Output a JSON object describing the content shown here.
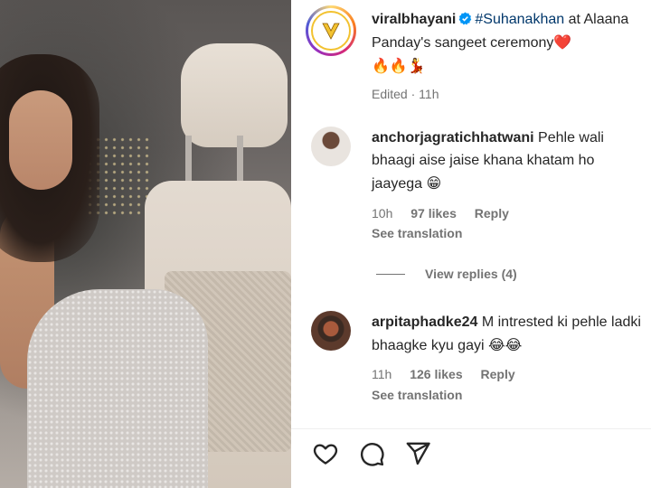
{
  "post": {
    "username": "viralbhayani",
    "hashtag": "#Suhanakhan",
    "caption_part1": " at Alaana Panday's sangeet ceremony",
    "caption_emoji_heart": "❤️",
    "caption_emojis_line2": "🔥🔥💃",
    "edited_label": "Edited",
    "separator": " · ",
    "time_ago": "11h"
  },
  "comments": [
    {
      "username": "anchorjagratichhatwani",
      "text": "Pehle wali bhaagi aise jaise khana khatam ho jaayega",
      "emoji": "😁",
      "time": "10h",
      "likes": "97 likes",
      "reply_label": "Reply",
      "see_translation": "See translation"
    },
    {
      "username": "arpitaphadke24",
      "text": "M intrested ki pehle ladki bhaagke kyu gayi",
      "emoji": "😂😂",
      "time": "11h",
      "likes": "126 likes",
      "reply_label": "Reply",
      "see_translation": "See translation"
    }
  ],
  "view_replies": "View replies (4)",
  "icons": {
    "like": "heart-icon",
    "comment": "comment-icon",
    "share": "share-icon",
    "verified": "verified-badge-icon",
    "logo": "viral-bhayani-logo"
  },
  "colors": {
    "hashtag": "#00376b",
    "verified": "#0095f6",
    "muted": "#737373",
    "logo_yellow": "#f2c230"
  }
}
